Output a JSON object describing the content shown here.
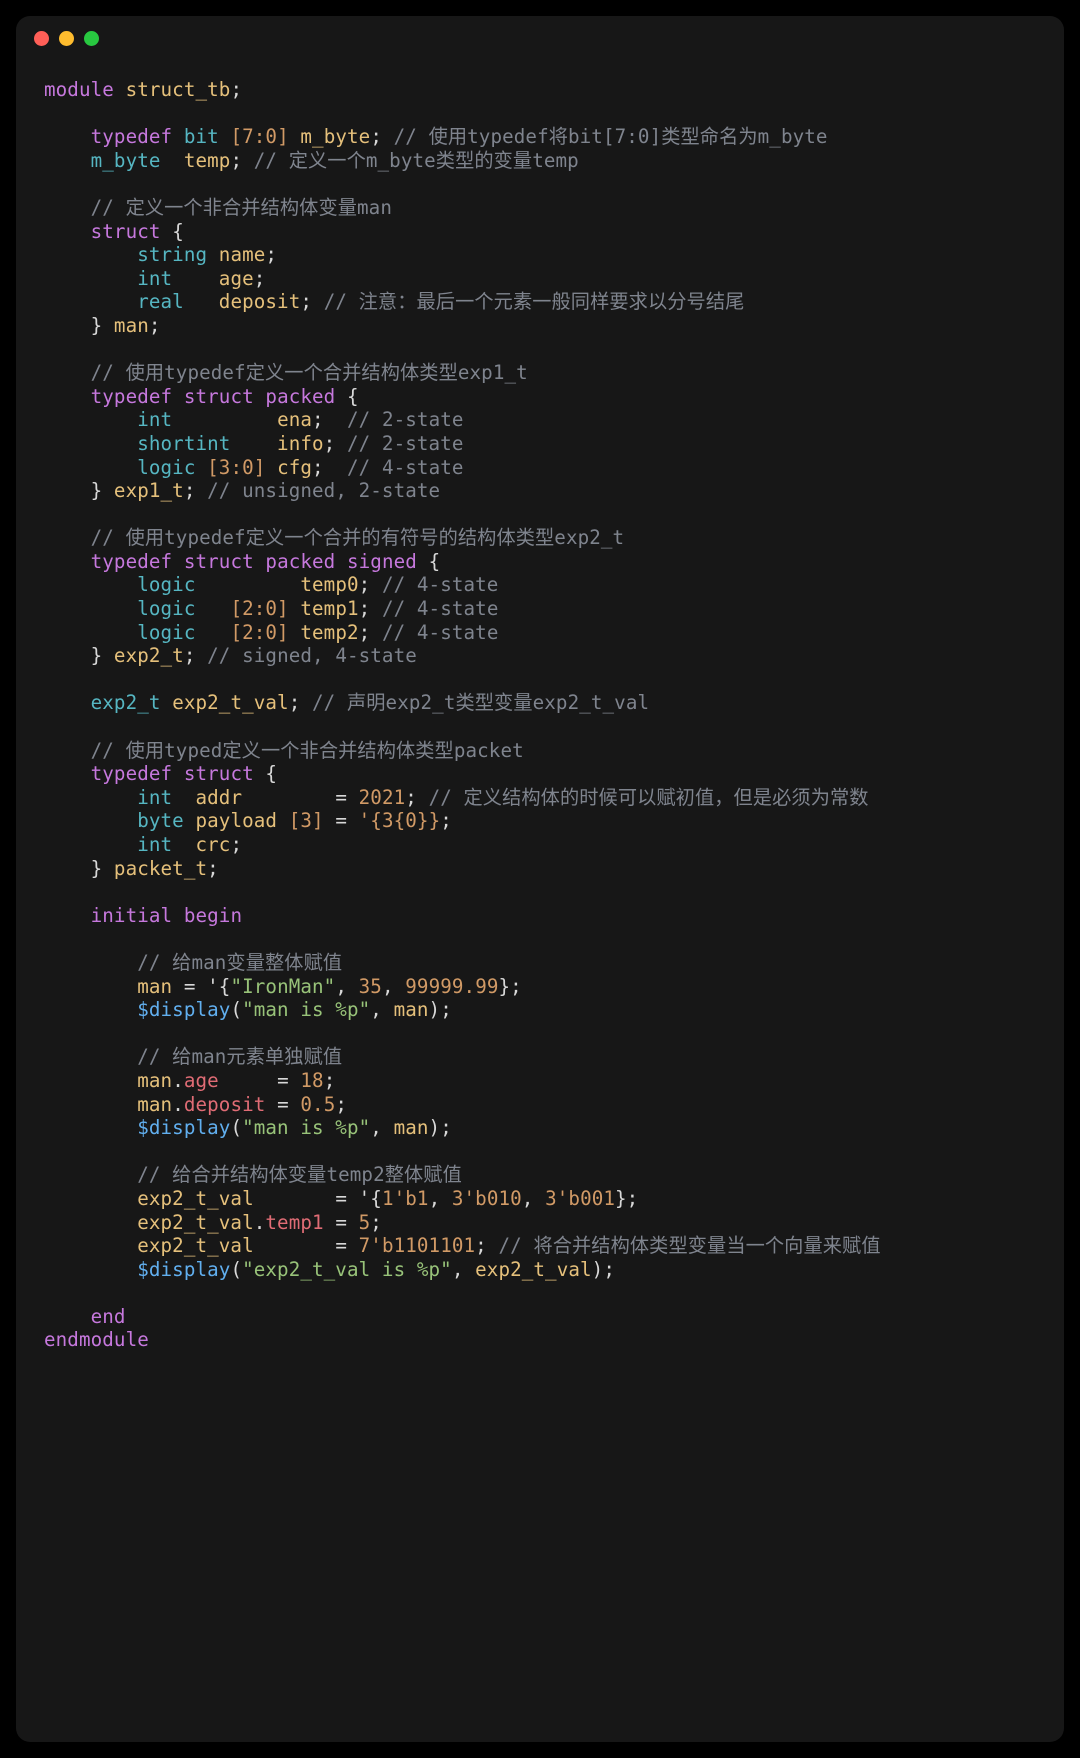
{
  "code": {
    "l01_kw_module": "module",
    "l01_name": "struct_tb",
    "l01_semi": ";",
    "l03_kw_typedef": "typedef",
    "l03_ty_bit": "bit",
    "l03_range": "[7:0]",
    "l03_nm": "m_byte",
    "l03_semi": ";",
    "l03_cm": "// 使用typedef将bit[7:0]类型命名为m_byte",
    "l04_ty": "m_byte",
    "l04_nm": "temp",
    "l04_semi": ";",
    "l04_cm": "// 定义一个m_byte类型的变量temp",
    "l06_cm": "// 定义一个非合并结构体变量man",
    "l07_kw_struct": "struct",
    "l07_brace": "{",
    "l08_ty": "string",
    "l08_nm": "name",
    "l08_semi": ";",
    "l09_ty": "int",
    "l09_nm": "age",
    "l09_semi": ";",
    "l10_ty": "real",
    "l10_nm": "deposit",
    "l10_semi": ";",
    "l10_cm": "// 注意：最后一个元素一般同样要求以分号结尾",
    "l11_brace": "}",
    "l11_nm": "man",
    "l11_semi": ";",
    "l13_cm": "// 使用typedef定义一个合并结构体类型exp1_t",
    "l14_kw_typedef": "typedef",
    "l14_kw_struct": "struct",
    "l14_kw_packed": "packed",
    "l14_brace": "{",
    "l15_ty": "int",
    "l15_nm": "ena",
    "l15_semi": ";",
    "l15_cm": "// 2-state",
    "l16_ty": "shortint",
    "l16_nm": "info",
    "l16_semi": ";",
    "l16_cm": "// 2-state",
    "l17_ty": "logic",
    "l17_range": "[3:0]",
    "l17_nm": "cfg",
    "l17_semi": ";",
    "l17_cm": "// 4-state",
    "l18_brace": "}",
    "l18_nm": "exp1_t",
    "l18_semi": ";",
    "l18_cm": "// unsigned, 2-state",
    "l20_cm": "// 使用typedef定义一个合并的有符号的结构体类型exp2_t",
    "l21_kw_typedef": "typedef",
    "l21_kw_struct": "struct",
    "l21_kw_packed": "packed",
    "l21_kw_signed": "signed",
    "l21_brace": "{",
    "l22_ty": "logic",
    "l22_nm": "temp0",
    "l22_semi": ";",
    "l22_cm": "// 4-state",
    "l23_ty": "logic",
    "l23_range": "[2:0]",
    "l23_nm": "temp1",
    "l23_semi": ";",
    "l23_cm": "// 4-state",
    "l24_ty": "logic",
    "l24_range": "[2:0]",
    "l24_nm": "temp2",
    "l24_semi": ";",
    "l24_cm": "// 4-state",
    "l25_brace": "}",
    "l25_nm": "exp2_t",
    "l25_semi": ";",
    "l25_cm": "// signed, 4-state",
    "l27_ty": "exp2_t",
    "l27_nm": "exp2_t_val",
    "l27_semi": ";",
    "l27_cm": "// 声明exp2_t类型变量exp2_t_val",
    "l29_cm": "// 使用typed定义一个非合并结构体类型packet",
    "l30_kw_typedef": "typedef",
    "l30_kw_struct": "struct",
    "l30_brace": "{",
    "l31_ty": "int",
    "l31_nm": "addr",
    "l31_eq": "=",
    "l31_val": "2021",
    "l31_semi": ";",
    "l31_cm": "// 定义结构体的时候可以赋初值，但是必须为常数",
    "l32_ty": "byte",
    "l32_nm": "payload",
    "l32_dim": "[3]",
    "l32_eq": "=",
    "l32_val": "'{3{0}}",
    "l32_semi": ";",
    "l33_ty": "int",
    "l33_nm": "crc",
    "l33_semi": ";",
    "l34_brace": "}",
    "l34_nm": "packet_t",
    "l34_semi": ";",
    "l36_kw_initial": "initial",
    "l36_kw_begin": "begin",
    "l38_cm": "// 给man变量整体赋值",
    "l39_nm": "man",
    "l39_eq": "=",
    "l39_open": "'{",
    "l39_s0": "\"IronMan\"",
    "l39_c0": ",",
    "l39_v1": "35",
    "l39_c1": ",",
    "l39_v2": "99999.99",
    "l39_close": "};",
    "l40_fn": "$display",
    "l40_s": "\"man is %p\"",
    "l40_c": ",",
    "l40_arg": "man",
    "l40_end": ");",
    "l42_cm": "// 给man元素单独赋值",
    "l43_nm": "man",
    "l43_dot": ".",
    "l43_fld": "age",
    "l43_eq": "=",
    "l43_val": "18",
    "l43_semi": ";",
    "l44_nm": "man",
    "l44_dot": ".",
    "l44_fld": "deposit",
    "l44_eq": "=",
    "l44_val": "0.5",
    "l44_semi": ";",
    "l45_fn": "$display",
    "l45_s": "\"man is %p\"",
    "l45_c": ",",
    "l45_arg": "man",
    "l45_end": ");",
    "l47_cm": "// 给合并结构体变量temp2整体赋值",
    "l48_nm": "exp2_t_val",
    "l48_eq": "=",
    "l48_open": "'{",
    "l48_v0": "1'b1",
    "l48_c0": ",",
    "l48_v1": "3'b010",
    "l48_c1": ",",
    "l48_v2": "3'b001",
    "l48_close": "};",
    "l49_nm": "exp2_t_val",
    "l49_dot": ".",
    "l49_fld": "temp1",
    "l49_eq": "=",
    "l49_val": "5",
    "l49_semi": ";",
    "l50_nm": "exp2_t_val",
    "l50_eq": "=",
    "l50_val": "7'b1101101",
    "l50_semi": ";",
    "l50_cm": "// 将合并结构体类型变量当一个向量来赋值",
    "l51_fn": "$display",
    "l51_s": "\"exp2_t_val is %p\"",
    "l51_c": ",",
    "l51_arg": "exp2_t_val",
    "l51_end": ");",
    "l53_kw_end": "end",
    "l54_kw_endmodule": "endmodule"
  }
}
